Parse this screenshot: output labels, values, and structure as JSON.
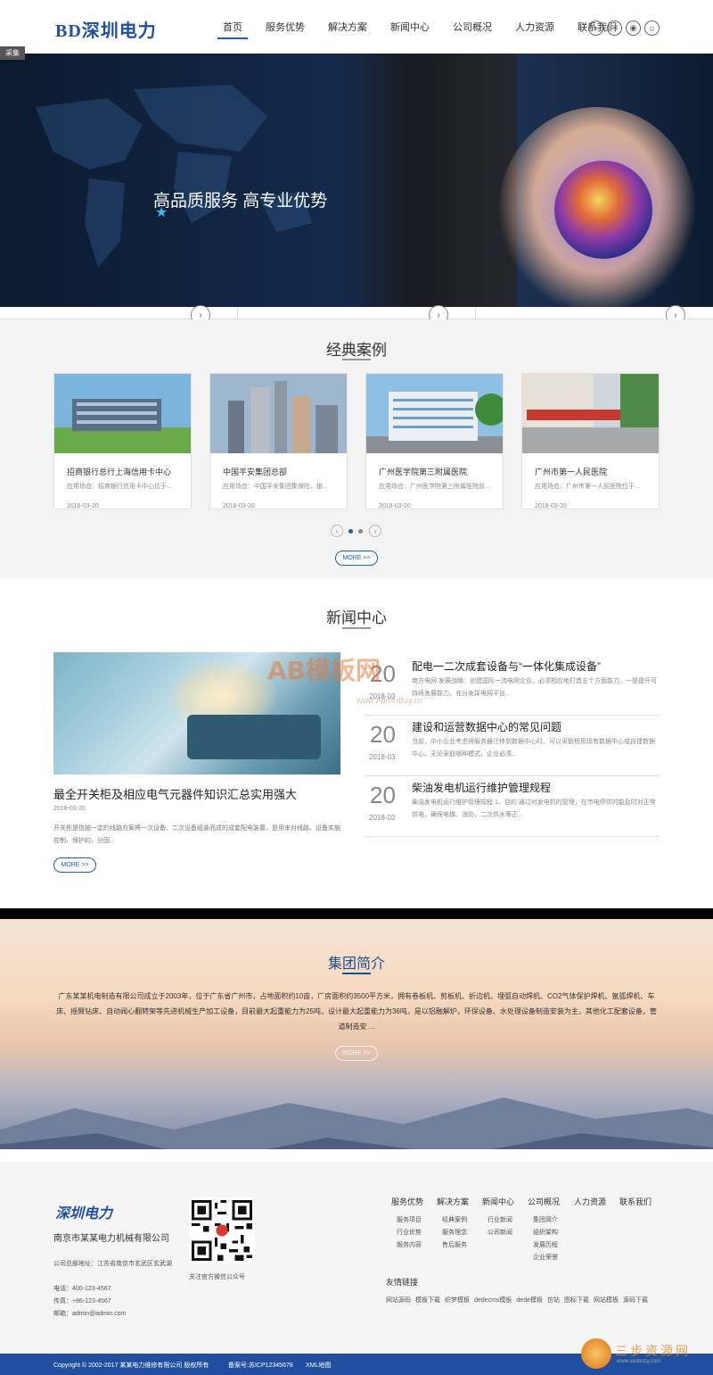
{
  "header": {
    "logo_bd": "BD",
    "logo_text": "深圳电力",
    "nav": [
      {
        "label": "首页",
        "active": true
      },
      {
        "label": "服务优势"
      },
      {
        "label": "解决方案"
      },
      {
        "label": "新闻中心"
      },
      {
        "label": "公司概况"
      },
      {
        "label": "人力资源"
      },
      {
        "label": "联系我们"
      }
    ],
    "icons": [
      "search-icon",
      "wechat-icon",
      "weibo-icon",
      "qq-icon"
    ]
  },
  "banner": {
    "tag": "采集",
    "title": "高品质服务 高专业优势",
    "slides": 4,
    "active_slide": 1
  },
  "cases": {
    "title": "经典案例",
    "items": [
      {
        "name": "招商银行总行上海信用卡中心",
        "desc": "应用场合：招商银行信用卡中心位于...",
        "date": "2018-03-20"
      },
      {
        "name": "中国平安集团总部",
        "desc": "应用场合：中国平安集团集保险、银...",
        "date": "2018-03-20"
      },
      {
        "name": "广州医学院第三附属医院",
        "desc": "应用场合：广州医学院第三附属医院前...",
        "date": "2018-03-20"
      },
      {
        "name": "广州市第一人民医院",
        "desc": "应用场合：广州市第一人民医院位于...",
        "date": "2018-03-20"
      }
    ],
    "more": "MORE >>"
  },
  "news": {
    "title": "新闻中心",
    "main": {
      "title": "最全开关柜及相应电气元器件知识汇总实用强大",
      "date": "2018-03-20",
      "desc": "开关柜是指按一定的线路方案将一次设备、二次设备组装而成的成套配电装置，是用来对线路、设备实施控制、保护的，分固..."
    },
    "items": [
      {
        "day": "20",
        "ym": "2018-03",
        "title": "配电一二次成套设备与“一体化集成设备”",
        "desc": "南方电网 发展战略：创建国际一流电网企业，必须相应地打造五个方面能力。一是提升可持续发展能力。充分发挥电网平台..."
      },
      {
        "day": "20",
        "ym": "2018-03",
        "title": "建设和运营数据中心的常见问题",
        "desc": "当前，中小企业考虑将服务器迁移到数据中心时，可以采取租用现有数据中心或自建数据中心。无论采取哪种模式，企业必须..."
      },
      {
        "day": "20",
        "ym": "2018-03",
        "title": "柴油发电机运行维护管理规程",
        "desc": "柴油发电机运行维护管理规程 1、目的 通过对发电机的管理，在市电停供时能及时对正常供电，确保电梯、消防、二次供水等正..."
      }
    ],
    "more": "MORE >>",
    "watermark": "AB模板网",
    "watermark_url": "www.AdminBuy.cn"
  },
  "about": {
    "title": "集团简介",
    "text": "广东某某机电制造有限公司成立于2003年，位于广东省广州市，占地面积约10亩，厂房面积约3500平方米，拥有卷板机、剪板机、折边机、埋弧自动焊机、CO2气体保护焊机、氩弧焊机、车床、摇臂钻床、自动阀心翻转架等先进机械生产加工设备，目前最大起重能力为25吨，设计最大起重能力为36吨，是以铝融解炉，环保设备、水处理设备制造安装为主，其他化工配套设备，管道制造安 ...",
    "more": "MORE >>"
  },
  "footer": {
    "logo": "深圳电力",
    "company": "南京市某某电力机械有限公司",
    "address": "公司总部地址：江苏省南京市玄武区玄武湖",
    "phone": "电话：400-123-4567",
    "fax": "传真：+86-123-4567",
    "email": "邮箱：admin@admin.com",
    "qr_label": "关注官方微信公众号",
    "columns": [
      {
        "title": "服务优势",
        "links": [
          "服务项目",
          "行业优势",
          "服务内容"
        ]
      },
      {
        "title": "解决方案",
        "links": [
          "经典案例",
          "服务理念",
          "售后服务"
        ]
      },
      {
        "title": "新闻中心",
        "links": [
          "行业新闻",
          "公司新闻"
        ]
      },
      {
        "title": "公司概况",
        "links": [
          "集团简介",
          "组织架构",
          "发展历程",
          "企业荣誉"
        ]
      },
      {
        "title": "人力资源",
        "links": []
      },
      {
        "title": "联系我们",
        "links": []
      }
    ],
    "links_title": "友情链接",
    "friend_links": [
      "网站源码",
      "模板下载",
      "织梦模板",
      "dedecms模板",
      "dede模板",
      "仿站",
      "图标下载",
      "网站模板",
      "源码下载"
    ],
    "copyright": "Copyright © 2002-2017 某某电力维修有限公司 版权所有",
    "icp": "备案号:苏ICP12345678",
    "sitemap": "XML地图",
    "badge_text": "三步资源网",
    "badge_url": "www.sanbuzy.com"
  }
}
